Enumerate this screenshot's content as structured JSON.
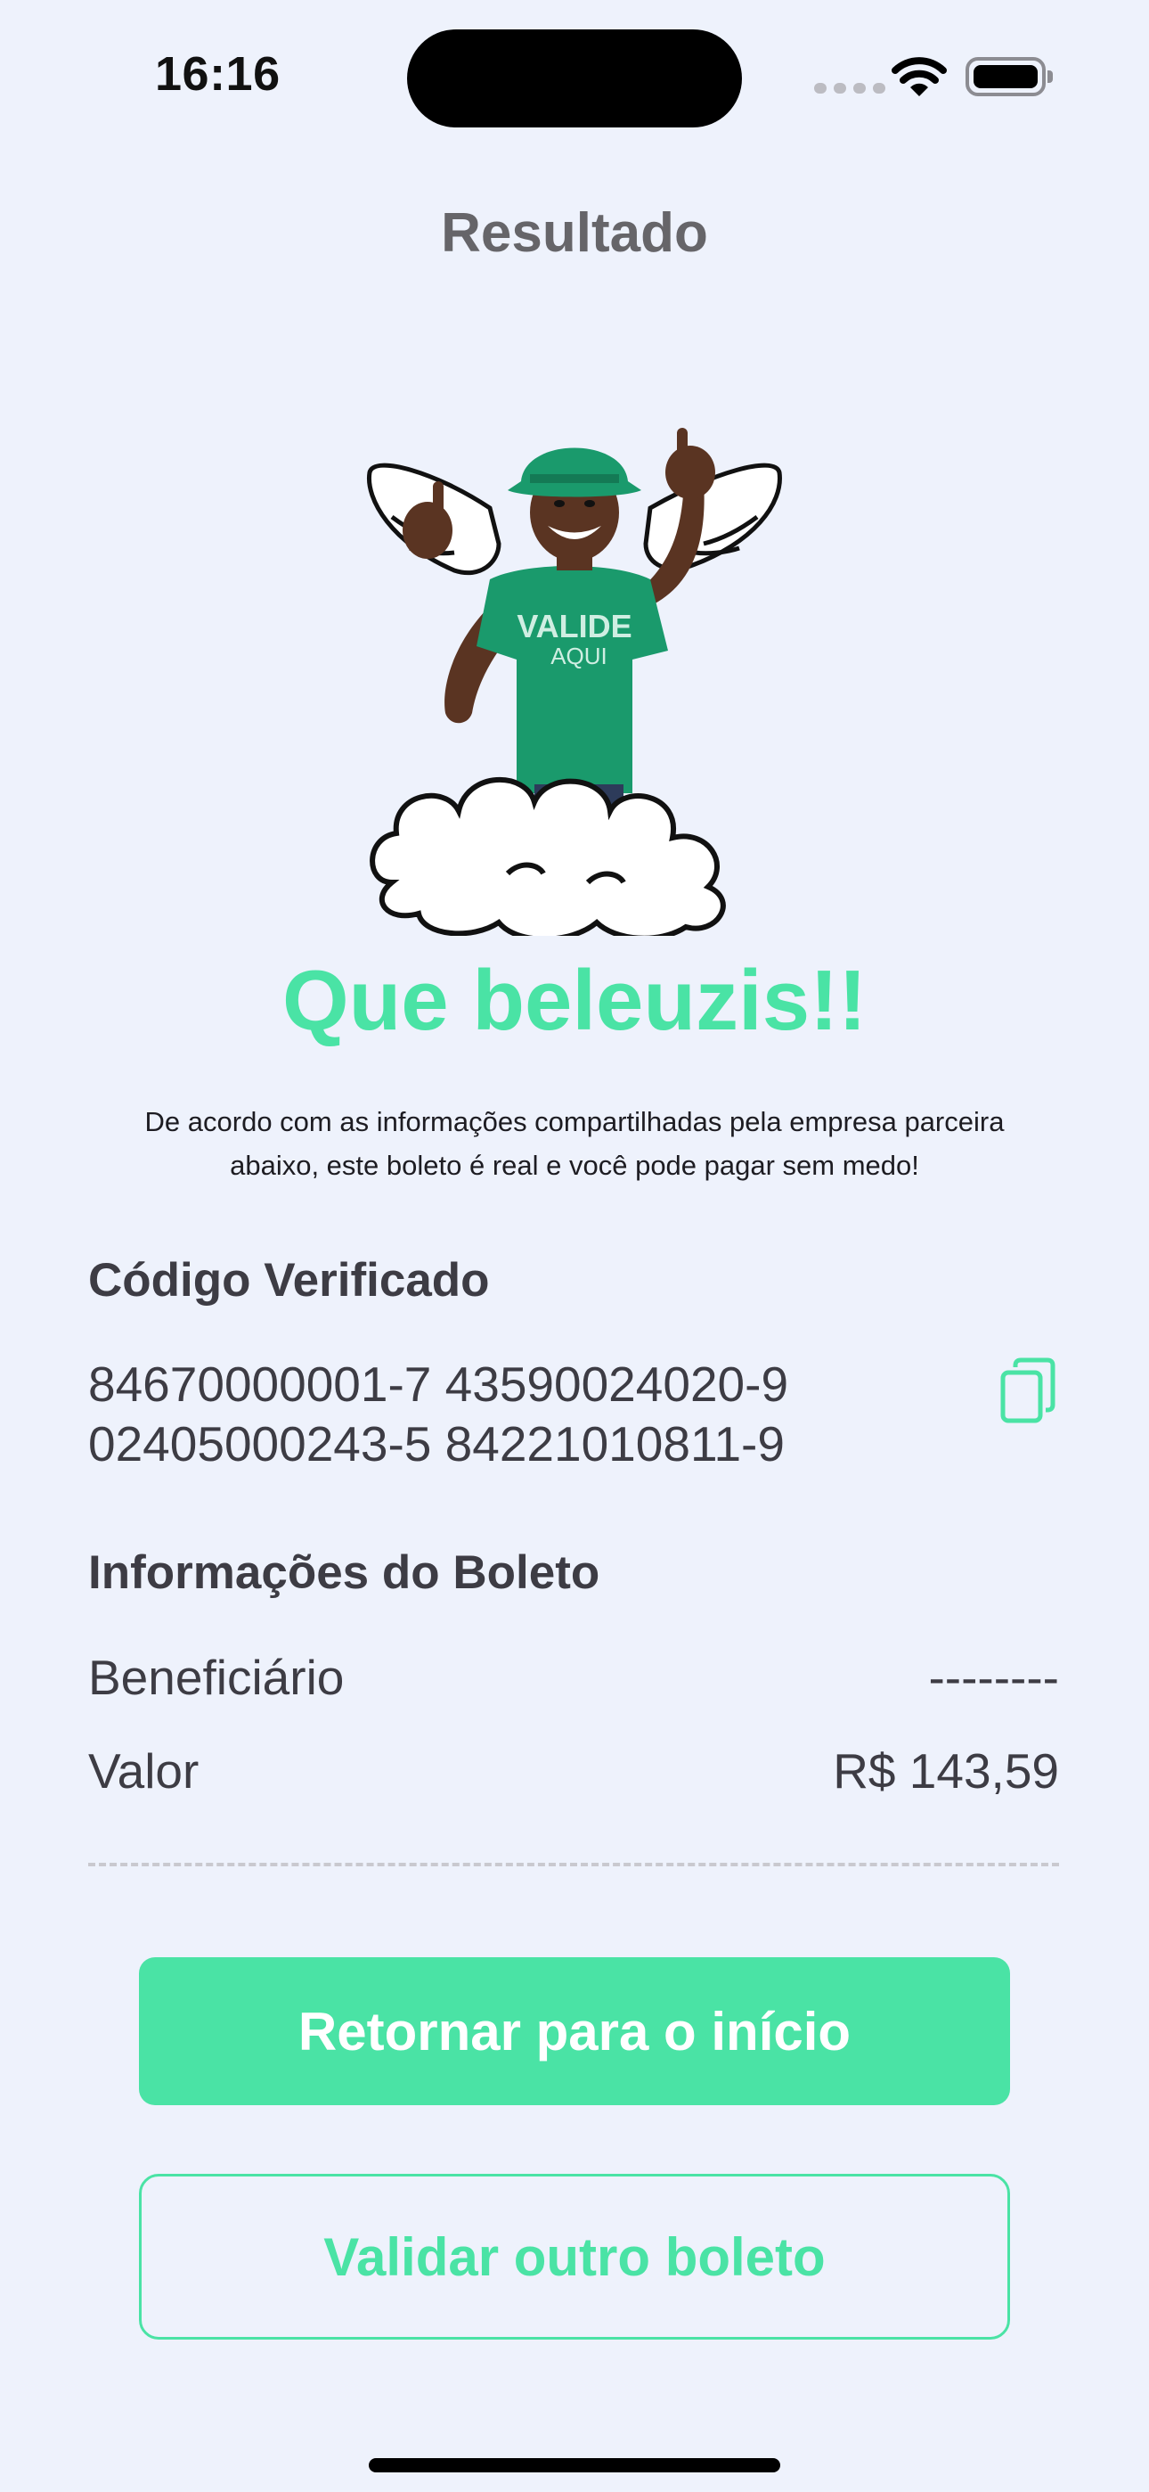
{
  "status_bar": {
    "time": "16:16"
  },
  "header": {
    "title": "Resultado"
  },
  "result": {
    "headline": "Que beleuzis!!",
    "description": "De acordo com as informações compartilhadas pela empresa parceira abaixo, este boleto é real e você pode pagar sem medo!",
    "mascot_shirt_text_line1": "VALIDE",
    "mascot_shirt_text_line2": "AQUI"
  },
  "verified_code": {
    "title": "Código Verificado",
    "line1": "84670000001-7 43590024020-9",
    "line2": "02405000243-5 84221010811-9",
    "copy_icon": "copy-icon"
  },
  "boleto_info": {
    "title": "Informações do Boleto",
    "rows": [
      {
        "label": "Beneficiário",
        "value": "--------"
      },
      {
        "label": "Valor",
        "value": "R$ 143,59"
      }
    ]
  },
  "actions": {
    "return_label": "Retornar para o início",
    "validate_other_label": "Validar outro boleto"
  },
  "colors": {
    "accent": "#4ae3a5",
    "background": "#eef2fc",
    "text": "#3d3c44",
    "title_gray": "#666569",
    "mascot_green": "#1a9a6c"
  }
}
